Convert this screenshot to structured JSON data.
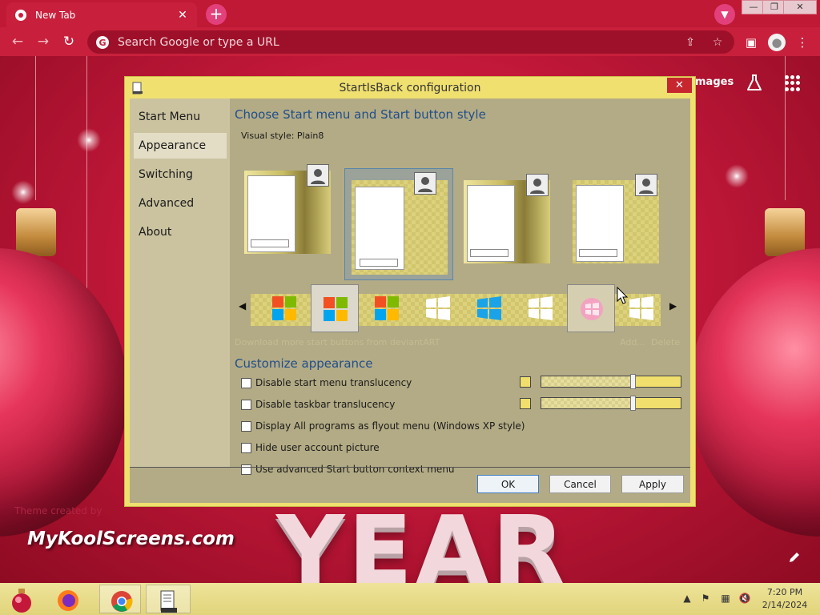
{
  "browser": {
    "tab_title": "New Tab",
    "omnibox_placeholder": "Search Google or type a URL",
    "images_link": "mages"
  },
  "wallpaper": {
    "brand": "MyKoolScreens.com",
    "theme_credit": "Theme created by",
    "big_text": "YEAR"
  },
  "dialog": {
    "title": "StartIsBack configuration",
    "sidebar": [
      {
        "label": "Start Menu"
      },
      {
        "label": "Appearance"
      },
      {
        "label": "Switching"
      },
      {
        "label": "Advanced"
      },
      {
        "label": "About"
      }
    ],
    "selected_sidebar": "Appearance",
    "style_section_title": "Choose Start menu and Start button style",
    "visual_style_label": "Visual style:",
    "visual_style_value": "Plain8",
    "selected_preview_index": 1,
    "selected_orb_index": 1,
    "download_link": "Download more start buttons from deviantART",
    "add_link": "Add...",
    "delete_link": "Delete",
    "customize_title": "Customize appearance",
    "options": [
      {
        "label": "Disable start menu translucency",
        "checked": false
      },
      {
        "label": "Disable taskbar translucency",
        "checked": false
      },
      {
        "label": "Display All programs as flyout menu (Windows XP style)",
        "checked": false
      },
      {
        "label": "Hide user account picture",
        "checked": false
      },
      {
        "label": "Use advanced Start button context menu",
        "checked": false
      }
    ],
    "ok_label": "OK",
    "cancel_label": "Cancel",
    "apply_label": "Apply"
  },
  "colors": {
    "accent_yellow": "#f0df6c",
    "dialog_body": "#b3ab85",
    "chrome_red": "#c8203c",
    "link_blue": "#1f4e8c"
  },
  "taskbar": {
    "time": "7:20 PM",
    "date": "2/14/2024"
  }
}
